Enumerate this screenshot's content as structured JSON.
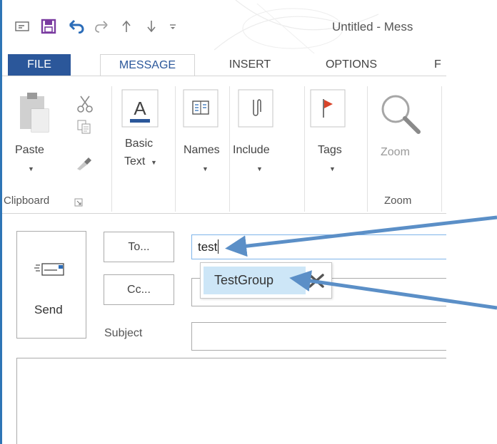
{
  "window": {
    "title": "Untitled - Mess"
  },
  "tabs": [
    {
      "label": "FILE"
    },
    {
      "label": "MESSAGE"
    },
    {
      "label": "INSERT"
    },
    {
      "label": "OPTIONS"
    },
    {
      "label": "F"
    }
  ],
  "ribbon": {
    "paste": "Paste",
    "basic_text_1": "Basic",
    "basic_text_2": "Text",
    "names": "Names",
    "include": "Include",
    "tags": "Tags",
    "zoom": "Zoom",
    "clipboard_group": "Clipboard",
    "zoom_group": "Zoom"
  },
  "compose": {
    "send": "Send",
    "to_button": "To...",
    "cc_button": "Cc...",
    "subject_label": "Subject",
    "to_value": "test",
    "suggestion": "TestGroup"
  },
  "colors": {
    "accent": "#2b579a",
    "arrow": "#5b8fc7",
    "suggest_highlight": "#cde6f7"
  },
  "icons": [
    "new-mail-icon",
    "save-icon",
    "undo-icon",
    "redo-icon",
    "up-arrow-icon",
    "down-arrow-icon",
    "customize-icon",
    "paste-icon",
    "cut-icon",
    "copy-icon",
    "format-painter-icon",
    "font-color-icon",
    "address-book-icon",
    "attach-icon",
    "flag-icon",
    "zoom-icon",
    "dialog-launcher-icon",
    "send-icon",
    "remove-icon"
  ]
}
